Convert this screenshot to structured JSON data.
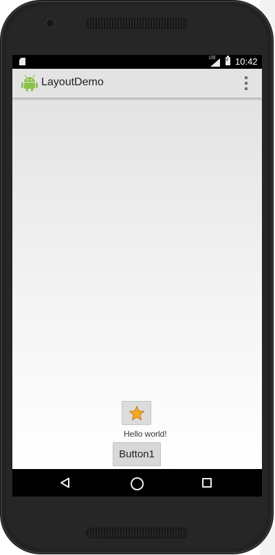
{
  "status_bar": {
    "time": "10:42",
    "network": "LTE",
    "icons": [
      "sd-card-icon",
      "lte-signal-icon",
      "battery-charging-icon"
    ]
  },
  "action_bar": {
    "title": "LayoutDemo",
    "icon": "android-icon",
    "overflow_icon": "overflow-menu-icon"
  },
  "content": {
    "image_button_icon": "star-icon",
    "hello_text": "Hello world!",
    "button1_label": "Button1"
  },
  "nav_bar": {
    "icons": [
      "back-icon",
      "home-icon",
      "recents-icon"
    ]
  },
  "colors": {
    "action_bar_bg": "#e3e3e3",
    "star_fill": "#f9a825",
    "android_green": "#8bc34a"
  }
}
